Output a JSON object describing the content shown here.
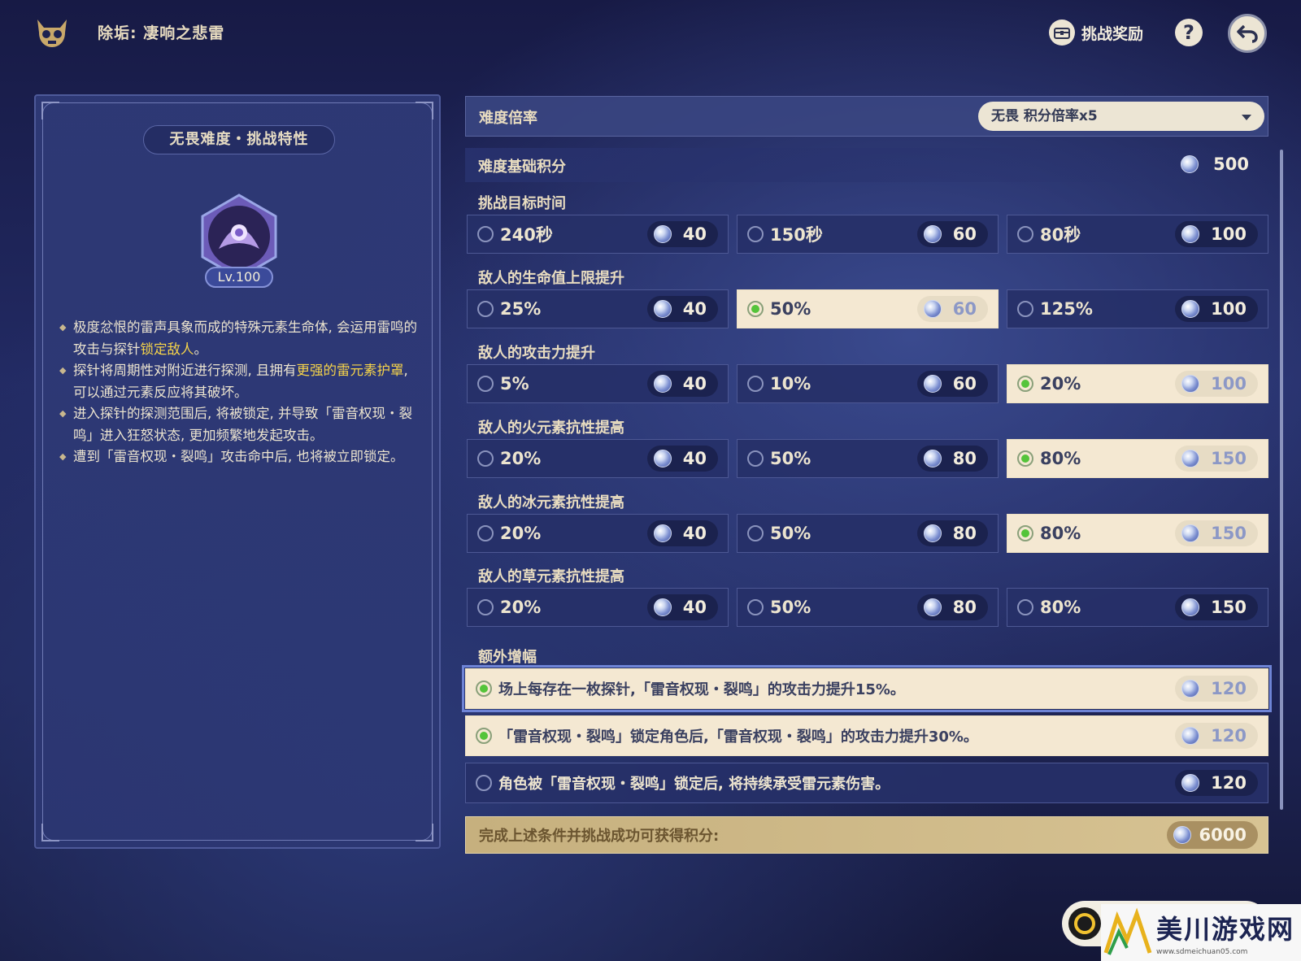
{
  "header": {
    "title": "除垢: 凄响之悲雷",
    "reward_label": "挑战奖励",
    "help_label": "?"
  },
  "left_panel": {
    "title": "无畏难度・挑战特性",
    "level": "Lv.100",
    "desc": [
      {
        "a": "极度忿恨的雷声具象而成的特殊元素生命体, 会运用雷鸣的攻击与探针",
        "hl": "锁定敌人",
        "b": "。"
      },
      {
        "a": "探针将周期性对附近进行探测, 且拥有",
        "hl": "更强的雷元素护罩",
        "b": ", 可以通过元素反应将其破坏。"
      },
      {
        "a": "进入探针的探测范围后, 将被锁定, 并导致「雷音权现・裂鸣」进入狂怒状态, 更加频繁地发起攻击。",
        "hl": "",
        "b": ""
      },
      {
        "a": "遭到「雷音权现・裂鸣」攻击命中后, 也将被立即锁定。",
        "hl": "",
        "b": ""
      }
    ]
  },
  "difficulty": {
    "label": "难度倍率",
    "selected": "无畏  积分倍率x5"
  },
  "base": {
    "label": "难度基础积分",
    "value": "500"
  },
  "groups": [
    {
      "label": "挑战目标时间",
      "options": [
        {
          "label": "240秒",
          "pts": "40",
          "selected": false
        },
        {
          "label": "150秒",
          "pts": "60",
          "selected": false
        },
        {
          "label": "80秒",
          "pts": "100",
          "selected": false
        }
      ]
    },
    {
      "label": "敌人的生命值上限提升",
      "options": [
        {
          "label": "25%",
          "pts": "40",
          "selected": false
        },
        {
          "label": "50%",
          "pts": "60",
          "selected": true
        },
        {
          "label": "125%",
          "pts": "100",
          "selected": false
        }
      ]
    },
    {
      "label": "敌人的攻击力提升",
      "options": [
        {
          "label": "5%",
          "pts": "40",
          "selected": false
        },
        {
          "label": "10%",
          "pts": "60",
          "selected": false
        },
        {
          "label": "20%",
          "pts": "100",
          "selected": true
        }
      ]
    },
    {
      "label": "敌人的火元素抗性提高",
      "options": [
        {
          "label": "20%",
          "pts": "40",
          "selected": false
        },
        {
          "label": "50%",
          "pts": "80",
          "selected": false
        },
        {
          "label": "80%",
          "pts": "150",
          "selected": true
        }
      ]
    },
    {
      "label": "敌人的冰元素抗性提高",
      "options": [
        {
          "label": "20%",
          "pts": "40",
          "selected": false
        },
        {
          "label": "50%",
          "pts": "80",
          "selected": false
        },
        {
          "label": "80%",
          "pts": "150",
          "selected": true
        }
      ]
    },
    {
      "label": "敌人的草元素抗性提高",
      "options": [
        {
          "label": "20%",
          "pts": "40",
          "selected": false
        },
        {
          "label": "50%",
          "pts": "80",
          "selected": false
        },
        {
          "label": "80%",
          "pts": "150",
          "selected": false
        }
      ]
    }
  ],
  "extra": {
    "label": "额外增幅",
    "items": [
      {
        "label": "场上每存在一枚探针,「雷音权现・裂鸣」的攻击力提升15%。",
        "pts": "120",
        "selected": true
      },
      {
        "label": "「雷音权现・裂鸣」锁定角色后,「雷音权现・裂鸣」的攻击力提升30%。",
        "pts": "120",
        "selected": true
      },
      {
        "label": "角色被「雷音权现・裂鸣」锁定后, 将持续承受雷元素伤害。",
        "pts": "120",
        "selected": false
      }
    ]
  },
  "total": {
    "label": "完成上述条件并挑战成功可获得积分:",
    "value": "6000"
  },
  "watermark": {
    "title": "美川游戏网",
    "url": "www.sdmeichuan05.com"
  },
  "icons": {
    "logo": "demon-mask-icon",
    "reward": "chest-icon",
    "help": "help-icon",
    "back": "back-arrow-icon",
    "gem": "primogem-icon"
  }
}
